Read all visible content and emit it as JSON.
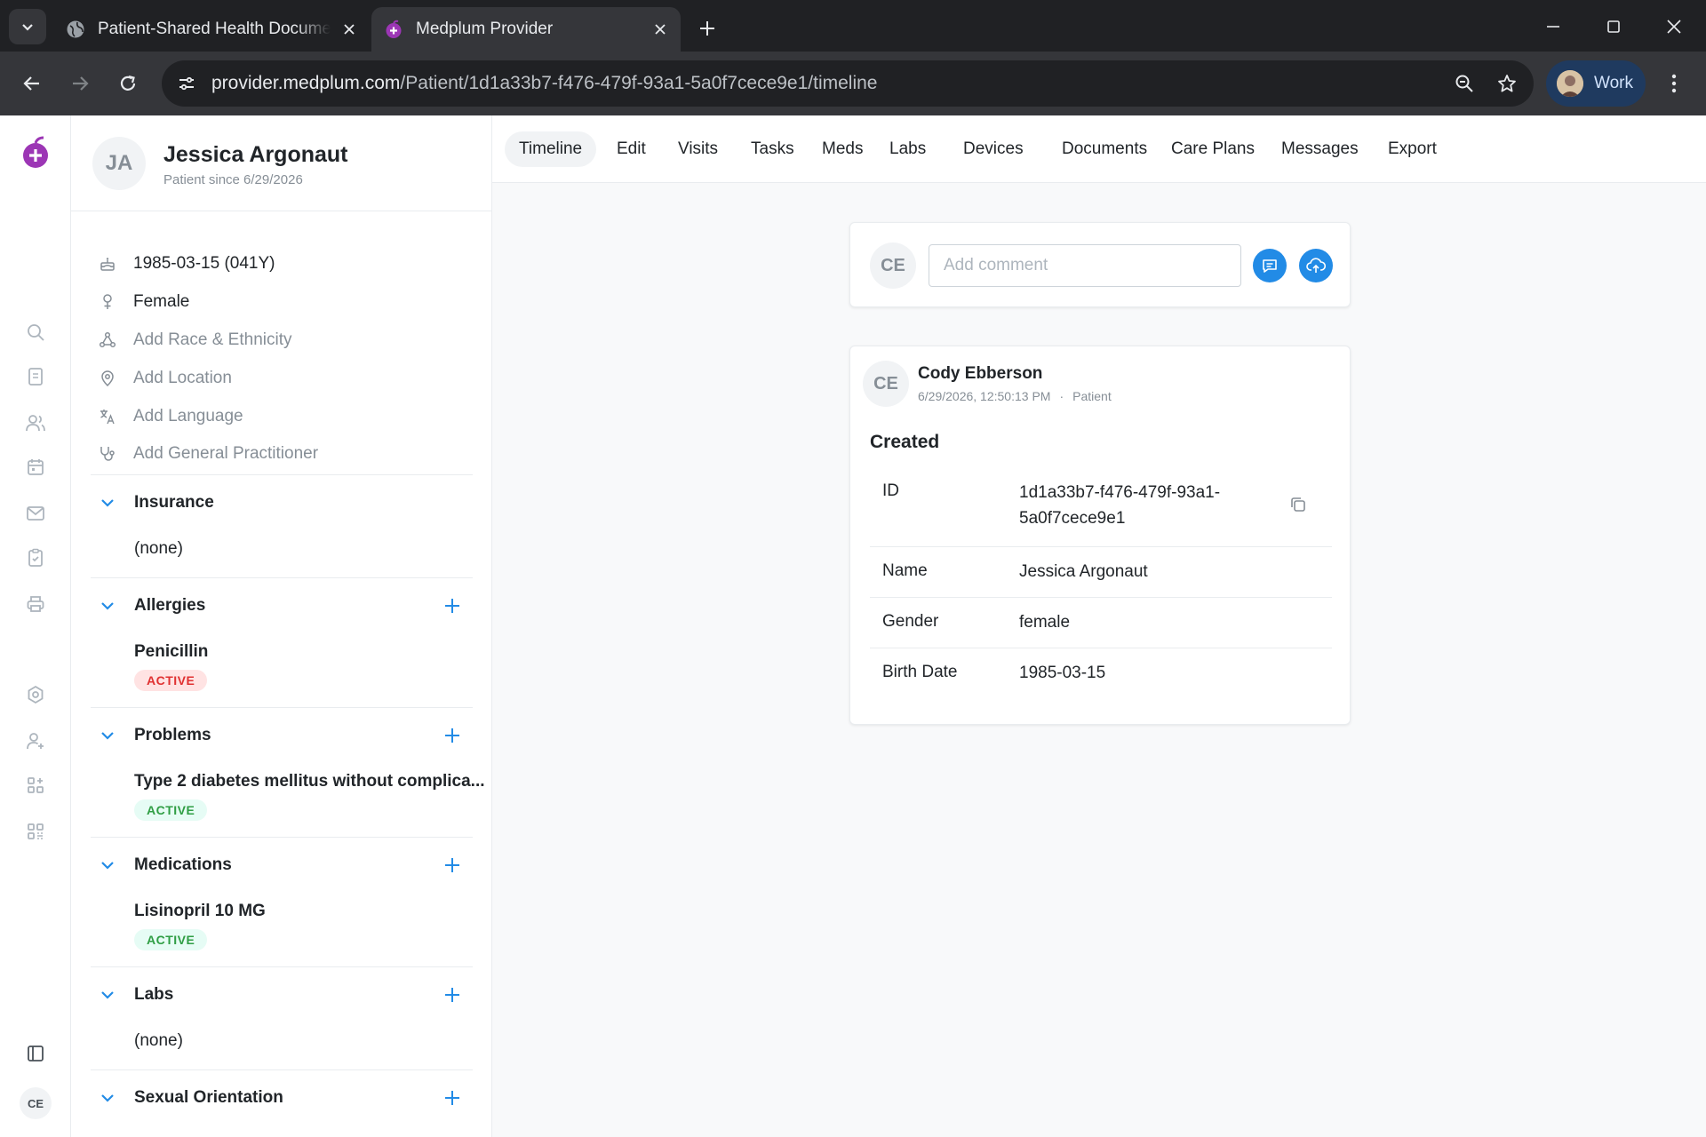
{
  "browser": {
    "tabs": [
      {
        "title": "Patient-Shared Health Documer",
        "favicon": "globe-icon"
      },
      {
        "title": "Medplum Provider",
        "favicon": "medplum-logo-icon"
      }
    ],
    "url": {
      "host": "provider.medplum.com",
      "path": "/Patient/1d1a33b7-f476-479f-93a1-5a0f7cece9e1/timeline"
    },
    "profile_label": "Work"
  },
  "rail": {
    "items": [
      "search-icon",
      "document-icon",
      "users-icon",
      "calendar-icon",
      "mail-icon",
      "clipboard-icon",
      "printer-icon",
      "settings-icon",
      "user-plus-icon",
      "apps-icon",
      "qrcode-icon",
      "sidebar-toggle-icon"
    ],
    "user_initials": "CE"
  },
  "patient": {
    "initials": "JA",
    "name": "Jessica Argonaut",
    "since": "Patient since 6/29/2026",
    "demographics": [
      {
        "icon": "birthday-cake-icon",
        "value": "1985-03-15 (041Y)",
        "placeholder": false
      },
      {
        "icon": "gender-icon",
        "value": "Female",
        "placeholder": false
      },
      {
        "icon": "race-ethnicity-icon",
        "value": "Add Race & Ethnicity",
        "placeholder": true
      },
      {
        "icon": "location-pin-icon",
        "value": "Add Location",
        "placeholder": true
      },
      {
        "icon": "language-icon",
        "value": "Add Language",
        "placeholder": true
      },
      {
        "icon": "stethoscope-icon",
        "value": "Add General Practitioner",
        "placeholder": true
      }
    ]
  },
  "sections": {
    "insurance": {
      "title": "Insurance",
      "item": "(none)"
    },
    "allergies": {
      "title": "Allergies",
      "item": "Penicillin",
      "status": "ACTIVE"
    },
    "problems": {
      "title": "Problems",
      "item": "Type 2 diabetes mellitus without complica...",
      "status": "ACTIVE"
    },
    "medications": {
      "title": "Medications",
      "item": "Lisinopril 10 MG",
      "status": "ACTIVE"
    },
    "labs": {
      "title": "Labs",
      "item": "(none)"
    },
    "sexual_orientation": {
      "title": "Sexual Orientation"
    }
  },
  "patient_tabs": [
    "Timeline",
    "Edit",
    "Visits",
    "Tasks",
    "Meds",
    "Labs",
    "Devices",
    "Documents",
    "Care Plans",
    "Messages",
    "Export"
  ],
  "active_tab": "Timeline",
  "comment": {
    "avatar_initials": "CE",
    "placeholder": "Add comment"
  },
  "event": {
    "avatar_initials": "CE",
    "author": "Cody Ebberson",
    "timestamp": "6/29/2026, 12:50:13 PM",
    "separator": "·",
    "context": "Patient",
    "heading": "Created",
    "rows": [
      {
        "key": "ID",
        "value_line1": "1d1a33b7-f476-479f-93a1-",
        "value_line2": "5a0f7cece9e1"
      },
      {
        "key": "Name",
        "value": "Jessica Argonaut"
      },
      {
        "key": "Gender",
        "value": "female"
      },
      {
        "key": "Birth Date",
        "value": "1985-03-15"
      }
    ]
  },
  "colors": {
    "accent_blue": "#228be6",
    "brand_purple": "#9c36b5",
    "active_red": "#e03131",
    "active_green": "#2f9e44"
  }
}
